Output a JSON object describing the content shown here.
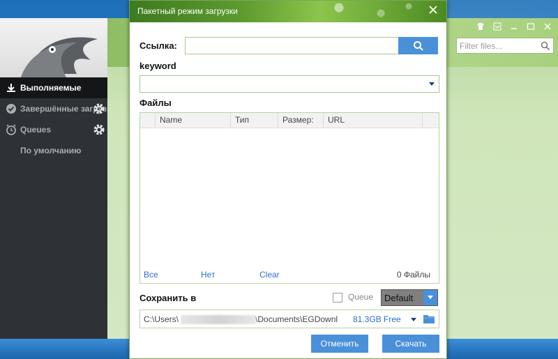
{
  "app": {
    "sidebar": {
      "items": [
        {
          "label": "Выполняемые",
          "icon": "download-icon",
          "active": true
        },
        {
          "label": "Завершённые загрузки",
          "icon": "check-circle-icon",
          "active": false
        },
        {
          "label": "Queues",
          "icon": "alarm-clock-icon",
          "active": false
        },
        {
          "label": "По умолчанию",
          "icon": "",
          "active": false
        }
      ]
    },
    "filter": {
      "placeholder": "Filter files..."
    }
  },
  "dialog": {
    "title": "Пакетный режим загрузки",
    "url_label": "Ссылка:",
    "url_value": "",
    "keyword_label": "keyword",
    "files_label": "Файлы",
    "columns": [
      "Name",
      "Тип",
      "Размер:",
      "URL"
    ],
    "rows": [],
    "select_all": "Все",
    "select_none": "Нет",
    "clear": "Clear",
    "files_count": "0 Файлы",
    "save_label": "Сохранить в",
    "queue_label": "Queue",
    "queue_checked": false,
    "queue_value": "Default",
    "path_start": "C:\\Users\\",
    "path_end": "\\Documents\\EGDownloads",
    "free_space": "81.3GB Free",
    "cancel_label": "Отменить",
    "download_label": "Скачать"
  },
  "colors": {
    "accent": "#4a90d9",
    "link": "#2a6fc9",
    "sidebar_bg": "#2e3136",
    "title_green": "#5c9a2e"
  }
}
